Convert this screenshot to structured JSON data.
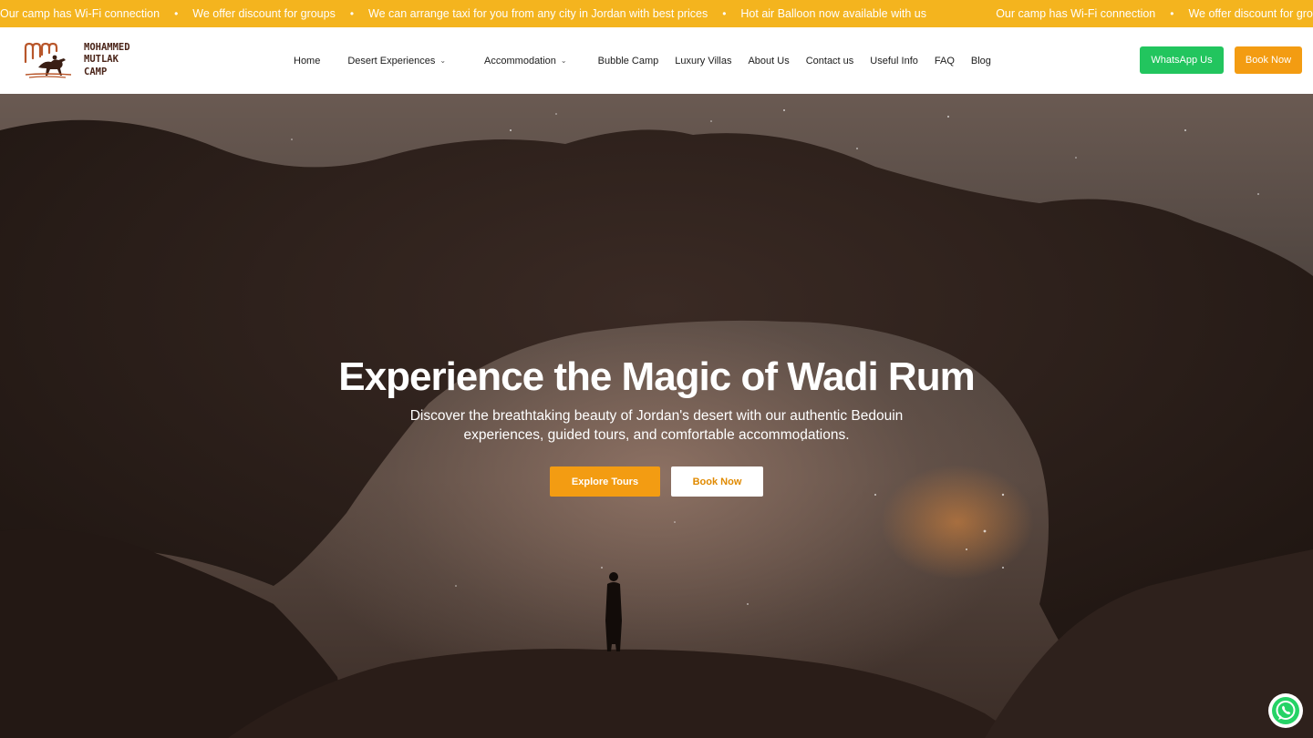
{
  "ticker": {
    "items": [
      "Our camp has Wi-Fi connection",
      "We offer discount for groups",
      "We can arrange taxi for you from any city in Jordan with best prices",
      "Hot air Balloon now available with us",
      "Our camp has Wi-Fi connection",
      "We offer discount for groups"
    ],
    "separator": "•"
  },
  "logo": {
    "line1": "MOHAMMED",
    "line2": "MUTLAK",
    "line3": "CAMP",
    "icon": "camel-rider-logo"
  },
  "nav": {
    "items": [
      {
        "label": "Home",
        "dropdown": false
      },
      {
        "label": "Desert Experiences",
        "dropdown": true
      },
      {
        "label": "Accommodation",
        "dropdown": true
      },
      {
        "label": "Bubble Camp",
        "dropdown": false
      },
      {
        "label": "Luxury Villas",
        "dropdown": false
      },
      {
        "label": "About Us",
        "dropdown": false
      },
      {
        "label": "Contact us",
        "dropdown": false
      },
      {
        "label": "Useful Info",
        "dropdown": false
      },
      {
        "label": "FAQ",
        "dropdown": false
      },
      {
        "label": "Blog",
        "dropdown": false
      }
    ],
    "caret": "⌄"
  },
  "header_buttons": {
    "whatsapp": "WhatsApp Us",
    "book": "Book Now"
  },
  "hero": {
    "title": "Experience the Magic of Wadi Rum",
    "subtitle_line1": "Discover the breathtaking beauty of Jordan's desert with our authentic Bedouin",
    "subtitle_line2": "experiences, guided tours, and comfortable accommodations.",
    "primary_button": "Explore Tours",
    "secondary_button": "Book Now"
  },
  "floating": {
    "icon": "whatsapp-icon"
  },
  "colors": {
    "ticker_bg": "#f4b41e",
    "accent_orange": "#f39c12",
    "whatsapp_green": "#22c55e",
    "logo_brown": "#4a2418"
  }
}
